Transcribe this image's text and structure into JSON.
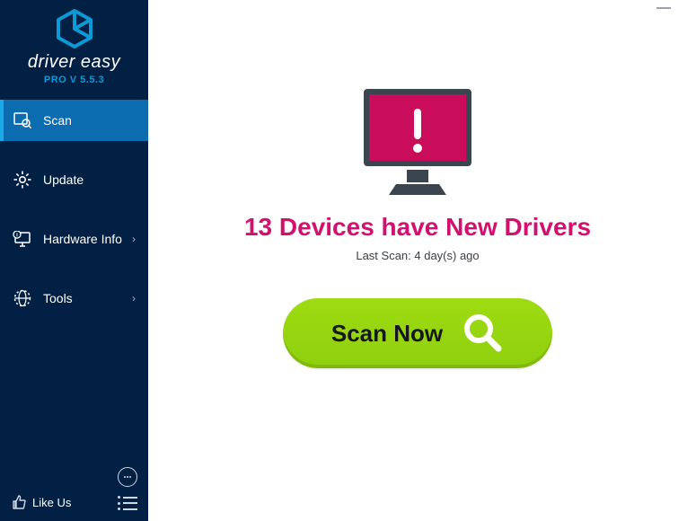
{
  "brand": {
    "name": "driver easy",
    "sub": "PRO V 5.5.3"
  },
  "nav": {
    "scan": "Scan",
    "update": "Update",
    "hardware": "Hardware Info",
    "tools": "Tools"
  },
  "sidebar_bottom": {
    "like_us": "Like Us"
  },
  "main": {
    "headline": "13 Devices have New Drivers",
    "lastscan": "Last Scan: 4 day(s) ago",
    "scan_label": "Scan Now"
  },
  "status": {
    "devices_with_new_drivers": 13,
    "last_scan_days_ago": 4
  },
  "colors": {
    "sidebar_bg": "#022044",
    "nav_active": "#0b6db0",
    "accent_blue": "#1aa8e6",
    "headline": "#d3106f",
    "scan_btn": "#93d310",
    "monitor_screen": "#c90d5b"
  }
}
